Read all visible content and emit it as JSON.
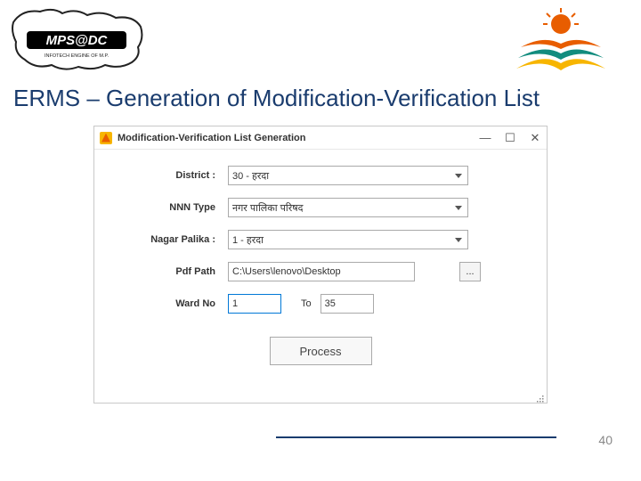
{
  "header": {
    "left_logo_main": "MPS@DC",
    "left_logo_sub": "INFOTECH ENGINE OF M.P."
  },
  "slide": {
    "title": "ERMS – Generation of Modification-Verification List",
    "page_number": "40"
  },
  "window": {
    "title": "Modification-Verification List Generation",
    "controls": {
      "min": "—",
      "max": "☐",
      "close": "✕"
    }
  },
  "form": {
    "district": {
      "label": "District :",
      "value": "30 - हरदा"
    },
    "nnn_type": {
      "label": "NNN Type",
      "value": "नगर पालिका परिषद"
    },
    "nagar_palika": {
      "label": "Nagar Palika :",
      "value": "1 - हरदा"
    },
    "pdf_path": {
      "label": "Pdf Path",
      "value": "C:\\Users\\lenovo\\Desktop",
      "browse": "..."
    },
    "ward": {
      "label": "Ward No",
      "from": "1",
      "to_label": "To",
      "to": "35"
    },
    "process": "Process"
  }
}
